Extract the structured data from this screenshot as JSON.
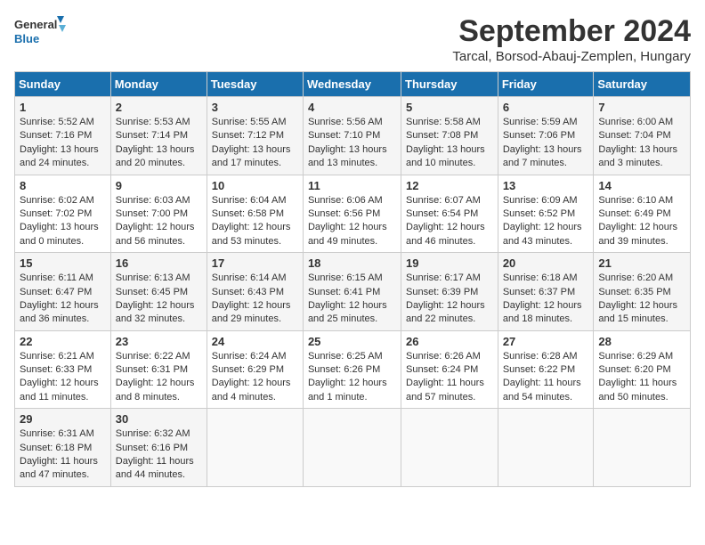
{
  "header": {
    "logo_line1": "General",
    "logo_line2": "Blue",
    "month": "September 2024",
    "location": "Tarcal, Borsod-Abauj-Zemplen, Hungary"
  },
  "weekdays": [
    "Sunday",
    "Monday",
    "Tuesday",
    "Wednesday",
    "Thursday",
    "Friday",
    "Saturday"
  ],
  "weeks": [
    [
      {
        "day": 1,
        "sunrise": "5:52 AM",
        "sunset": "7:16 PM",
        "daylight": "13 hours and 24 minutes."
      },
      {
        "day": 2,
        "sunrise": "5:53 AM",
        "sunset": "7:14 PM",
        "daylight": "13 hours and 20 minutes."
      },
      {
        "day": 3,
        "sunrise": "5:55 AM",
        "sunset": "7:12 PM",
        "daylight": "13 hours and 17 minutes."
      },
      {
        "day": 4,
        "sunrise": "5:56 AM",
        "sunset": "7:10 PM",
        "daylight": "13 hours and 13 minutes."
      },
      {
        "day": 5,
        "sunrise": "5:58 AM",
        "sunset": "7:08 PM",
        "daylight": "13 hours and 10 minutes."
      },
      {
        "day": 6,
        "sunrise": "5:59 AM",
        "sunset": "7:06 PM",
        "daylight": "13 hours and 7 minutes."
      },
      {
        "day": 7,
        "sunrise": "6:00 AM",
        "sunset": "7:04 PM",
        "daylight": "13 hours and 3 minutes."
      }
    ],
    [
      {
        "day": 8,
        "sunrise": "6:02 AM",
        "sunset": "7:02 PM",
        "daylight": "13 hours and 0 minutes."
      },
      {
        "day": 9,
        "sunrise": "6:03 AM",
        "sunset": "7:00 PM",
        "daylight": "12 hours and 56 minutes."
      },
      {
        "day": 10,
        "sunrise": "6:04 AM",
        "sunset": "6:58 PM",
        "daylight": "12 hours and 53 minutes."
      },
      {
        "day": 11,
        "sunrise": "6:06 AM",
        "sunset": "6:56 PM",
        "daylight": "12 hours and 49 minutes."
      },
      {
        "day": 12,
        "sunrise": "6:07 AM",
        "sunset": "6:54 PM",
        "daylight": "12 hours and 46 minutes."
      },
      {
        "day": 13,
        "sunrise": "6:09 AM",
        "sunset": "6:52 PM",
        "daylight": "12 hours and 43 minutes."
      },
      {
        "day": 14,
        "sunrise": "6:10 AM",
        "sunset": "6:49 PM",
        "daylight": "12 hours and 39 minutes."
      }
    ],
    [
      {
        "day": 15,
        "sunrise": "6:11 AM",
        "sunset": "6:47 PM",
        "daylight": "12 hours and 36 minutes."
      },
      {
        "day": 16,
        "sunrise": "6:13 AM",
        "sunset": "6:45 PM",
        "daylight": "12 hours and 32 minutes."
      },
      {
        "day": 17,
        "sunrise": "6:14 AM",
        "sunset": "6:43 PM",
        "daylight": "12 hours and 29 minutes."
      },
      {
        "day": 18,
        "sunrise": "6:15 AM",
        "sunset": "6:41 PM",
        "daylight": "12 hours and 25 minutes."
      },
      {
        "day": 19,
        "sunrise": "6:17 AM",
        "sunset": "6:39 PM",
        "daylight": "12 hours and 22 minutes."
      },
      {
        "day": 20,
        "sunrise": "6:18 AM",
        "sunset": "6:37 PM",
        "daylight": "12 hours and 18 minutes."
      },
      {
        "day": 21,
        "sunrise": "6:20 AM",
        "sunset": "6:35 PM",
        "daylight": "12 hours and 15 minutes."
      }
    ],
    [
      {
        "day": 22,
        "sunrise": "6:21 AM",
        "sunset": "6:33 PM",
        "daylight": "12 hours and 11 minutes."
      },
      {
        "day": 23,
        "sunrise": "6:22 AM",
        "sunset": "6:31 PM",
        "daylight": "12 hours and 8 minutes."
      },
      {
        "day": 24,
        "sunrise": "6:24 AM",
        "sunset": "6:29 PM",
        "daylight": "12 hours and 4 minutes."
      },
      {
        "day": 25,
        "sunrise": "6:25 AM",
        "sunset": "6:26 PM",
        "daylight": "12 hours and 1 minute."
      },
      {
        "day": 26,
        "sunrise": "6:26 AM",
        "sunset": "6:24 PM",
        "daylight": "11 hours and 57 minutes."
      },
      {
        "day": 27,
        "sunrise": "6:28 AM",
        "sunset": "6:22 PM",
        "daylight": "11 hours and 54 minutes."
      },
      {
        "day": 28,
        "sunrise": "6:29 AM",
        "sunset": "6:20 PM",
        "daylight": "11 hours and 50 minutes."
      }
    ],
    [
      {
        "day": 29,
        "sunrise": "6:31 AM",
        "sunset": "6:18 PM",
        "daylight": "11 hours and 47 minutes."
      },
      {
        "day": 30,
        "sunrise": "6:32 AM",
        "sunset": "6:16 PM",
        "daylight": "11 hours and 44 minutes."
      },
      null,
      null,
      null,
      null,
      null
    ]
  ]
}
